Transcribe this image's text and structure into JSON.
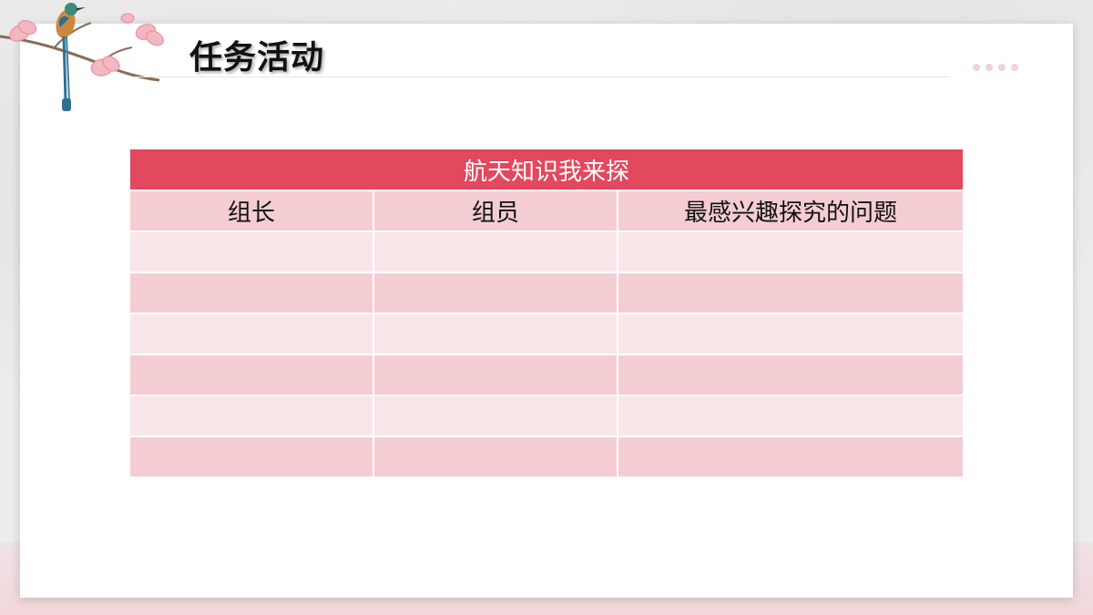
{
  "slide": {
    "title": "任务活动"
  },
  "table": {
    "title": "航天知识我来探",
    "headers": [
      "组长",
      "组员",
      "最感兴趣探究的问题"
    ],
    "rows": [
      [
        "",
        "",
        ""
      ],
      [
        "",
        "",
        ""
      ],
      [
        "",
        "",
        ""
      ],
      [
        "",
        "",
        ""
      ],
      [
        "",
        "",
        ""
      ],
      [
        "",
        "",
        ""
      ]
    ]
  },
  "colors": {
    "accent": "#e2485e",
    "header_fill": "#f4cdd3",
    "row_light": "#f9e6e8"
  },
  "decoration": {
    "corner_icon": "bird-on-magnolia-branch-icon"
  }
}
